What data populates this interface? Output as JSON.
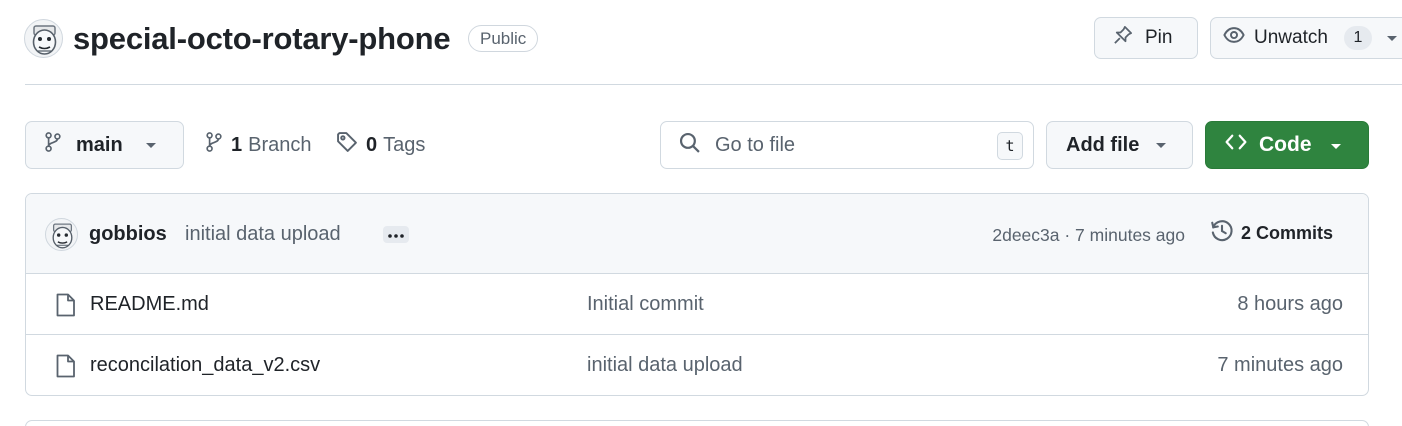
{
  "repo": {
    "name": "special-octo-rotary-phone",
    "visibility": "Public"
  },
  "actions": {
    "pin_label": "Pin",
    "watch_label": "Unwatch",
    "watch_count": "1"
  },
  "toolbar": {
    "branch_label": "main",
    "branch_count": "1",
    "branch_word": "Branch",
    "tag_count": "0",
    "tag_word": "Tags",
    "search_placeholder": "Go to file",
    "search_shortcut": "t",
    "add_file_label": "Add file",
    "code_label": "Code"
  },
  "latest_commit": {
    "author": "gobbios",
    "message": "initial data upload",
    "info": "2deec3a · 7 minutes ago",
    "commits_label": "2 Commits"
  },
  "files": [
    {
      "name": "README.md",
      "message": "Initial commit",
      "age": "8 hours ago",
      "icon": "file-icon"
    },
    {
      "name": "reconcilation_data_v2.csv",
      "message": "initial data upload",
      "age": "7 minutes ago",
      "icon": "file-icon"
    }
  ],
  "colors": {
    "primary_button": "#2f843f",
    "border": "#d1d9e0",
    "muted_text": "#59636e"
  }
}
